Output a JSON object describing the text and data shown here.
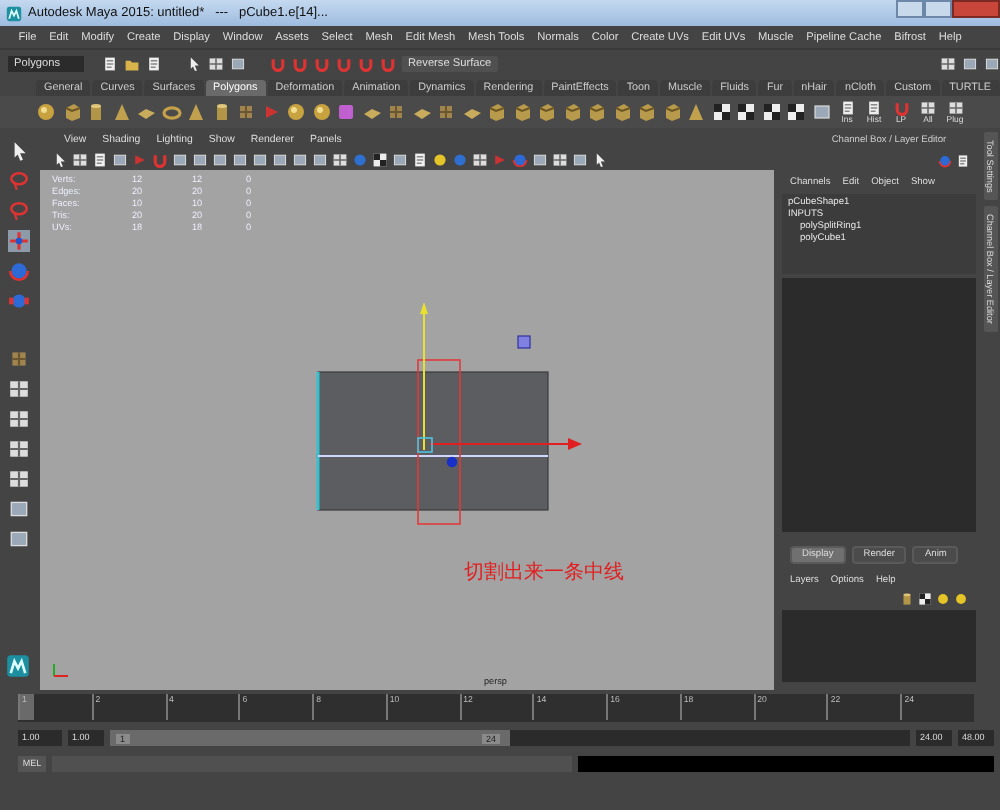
{
  "window": {
    "title": "Autodesk Maya 2015: untitled*   ---   pCube1.e[14]..."
  },
  "menu_set": "Polygons",
  "menus": [
    "File",
    "Edit",
    "Modify",
    "Create",
    "Display",
    "Window",
    "Assets",
    "Select",
    "Mesh",
    "Edit Mesh",
    "Mesh Tools",
    "Normals",
    "Color",
    "Create UVs",
    "Edit UVs",
    "Muscle",
    "Pipeline Cache",
    "Bifrost",
    "Help"
  ],
  "status_line": {
    "button": "Reverse Surface"
  },
  "shelf_tabs": [
    {
      "label": "General",
      "selected": false
    },
    {
      "label": "Curves",
      "selected": false
    },
    {
      "label": "Surfaces",
      "selected": false
    },
    {
      "label": "Polygons",
      "selected": true
    },
    {
      "label": "Deformation",
      "selected": false
    },
    {
      "label": "Animation",
      "selected": false
    },
    {
      "label": "Dynamics",
      "selected": false
    },
    {
      "label": "Rendering",
      "selected": false
    },
    {
      "label": "PaintEffects",
      "selected": false
    },
    {
      "label": "Toon",
      "selected": false
    },
    {
      "label": "Muscle",
      "selected": false
    },
    {
      "label": "Fluids",
      "selected": false
    },
    {
      "label": "Fur",
      "selected": false
    },
    {
      "label": "nHair",
      "selected": false
    },
    {
      "label": "nCloth",
      "selected": false
    },
    {
      "label": "Custom",
      "selected": false
    },
    {
      "label": "TURTLE",
      "selected": false
    }
  ],
  "shelf_buttons": [
    "Ins",
    "Hist",
    "LP",
    "All",
    "Plug"
  ],
  "panel_menus": [
    "View",
    "Shading",
    "Lighting",
    "Show",
    "Renderer",
    "Panels"
  ],
  "hud": [
    {
      "label": "Verts:",
      "values": [
        "12",
        "12",
        "0"
      ]
    },
    {
      "label": "Edges:",
      "values": [
        "20",
        "20",
        "0"
      ]
    },
    {
      "label": "Faces:",
      "values": [
        "10",
        "10",
        "0"
      ]
    },
    {
      "label": "Tris:",
      "values": [
        "20",
        "20",
        "0"
      ]
    },
    {
      "label": "UVs:",
      "values": [
        "18",
        "18",
        "0"
      ]
    }
  ],
  "viewport": {
    "annotation": "切割出来一条中线",
    "camera": "persp"
  },
  "channel_box": {
    "title": "Channel Box / Layer Editor",
    "menus": [
      "Channels",
      "Edit",
      "Object",
      "Show"
    ],
    "object": "pCubeShape1",
    "inputs_label": "INPUTS",
    "inputs": [
      "polySplitRing1",
      "polyCube1"
    ]
  },
  "side_tabs": [
    "Tool Settings",
    "Channel Box / Layer Editor"
  ],
  "layer_editor": {
    "tabs": [
      {
        "label": "Display",
        "selected": true
      },
      {
        "label": "Render",
        "selected": false
      },
      {
        "label": "Anim",
        "selected": false
      }
    ],
    "menus": [
      "Layers",
      "Options",
      "Help"
    ]
  },
  "timeline": {
    "level": 0,
    "ticks": [
      "1",
      "2",
      "4",
      "6",
      "8",
      "10",
      "12",
      "14",
      "16",
      "18",
      "20",
      "22",
      "24"
    ]
  },
  "range": {
    "start": "1.00",
    "current": "1.00",
    "slider_start": "1",
    "slider_end": "24",
    "end": "24.00",
    "anim_end": "48.00",
    "level": 0.5
  },
  "command_line": {
    "label": "MEL"
  }
}
